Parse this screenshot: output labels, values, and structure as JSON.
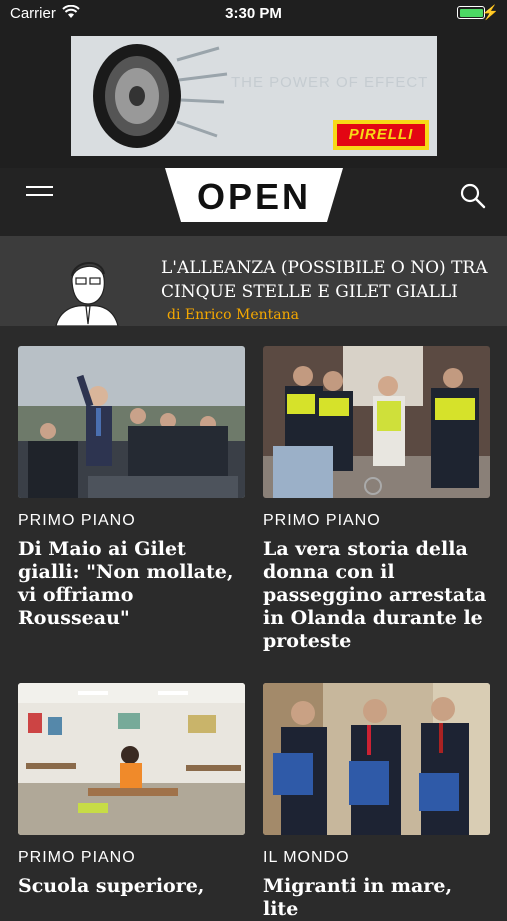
{
  "status_bar": {
    "carrier": "Carrier",
    "time": "3:30 PM"
  },
  "ad": {
    "tagline": "THE POWER OF EFFECT",
    "brand": "PIRELLI"
  },
  "header": {
    "logo": "OPEN"
  },
  "editorial": {
    "title": "L'ALLEANZA (POSSIBILE O NO) TRA CINQUE STELLE E GILET GIALLI",
    "byline": "di Enrico Mentana"
  },
  "articles": [
    {
      "category": "PRIMO PIANO",
      "headline": "Di Maio ai Gilet gialli: \"Non mollate, vi offriamo Rousseau\""
    },
    {
      "category": "PRIMO PIANO",
      "headline": "La vera storia della donna con il passeggino arrestata in Olanda durante le proteste"
    },
    {
      "category": "PRIMO PIANO",
      "headline": "Scuola superiore,"
    },
    {
      "category": "IL MONDO",
      "headline": "Migranti in mare, lite"
    }
  ]
}
